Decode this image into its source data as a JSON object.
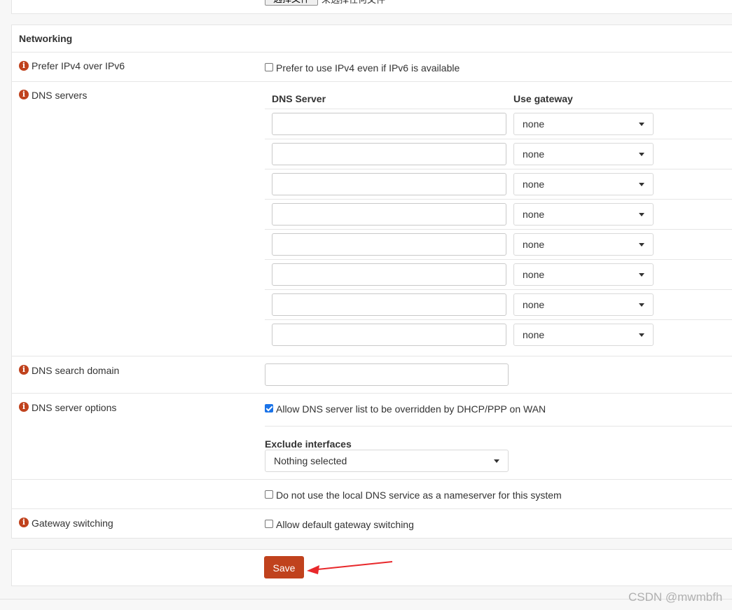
{
  "top_panel": {
    "file_button_label": "选择文件",
    "file_status": "未选择任何文件"
  },
  "networking": {
    "title": "Networking",
    "prefer_ipv4": {
      "label": "Prefer IPv4 over IPv6",
      "checkbox_text": "Prefer to use IPv4 even if IPv6 is available",
      "checked": false
    },
    "dns_servers": {
      "label": "DNS servers",
      "col_server": "DNS Server",
      "col_gateway": "Use gateway",
      "rows": [
        {
          "server": "",
          "gateway": "none"
        },
        {
          "server": "",
          "gateway": "none"
        },
        {
          "server": "",
          "gateway": "none"
        },
        {
          "server": "",
          "gateway": "none"
        },
        {
          "server": "",
          "gateway": "none"
        },
        {
          "server": "",
          "gateway": "none"
        },
        {
          "server": "",
          "gateway": "none"
        },
        {
          "server": "",
          "gateway": "none"
        }
      ]
    },
    "dns_search_domain": {
      "label": "DNS search domain",
      "value": ""
    },
    "dns_server_options": {
      "label": "DNS server options",
      "allow_override_text": "Allow DNS server list to be overridden by DHCP/PPP on WAN",
      "allow_override_checked": true,
      "exclude_interfaces_label": "Exclude interfaces",
      "exclude_interfaces_value": "Nothing selected",
      "no_local_dns_text": "Do not use the local DNS service as a nameserver for this system",
      "no_local_dns_checked": false
    },
    "gateway_switching": {
      "label": "Gateway switching",
      "checkbox_text": "Allow default gateway switching",
      "checked": false
    }
  },
  "save_label": "Save",
  "info_icon_glyph": "i",
  "watermark": "CSDN @mwmbfh",
  "colors": {
    "accent": "#c0421d",
    "checkbox_checked": "#1a73e8",
    "annotation_arrow": "#e8282b"
  }
}
